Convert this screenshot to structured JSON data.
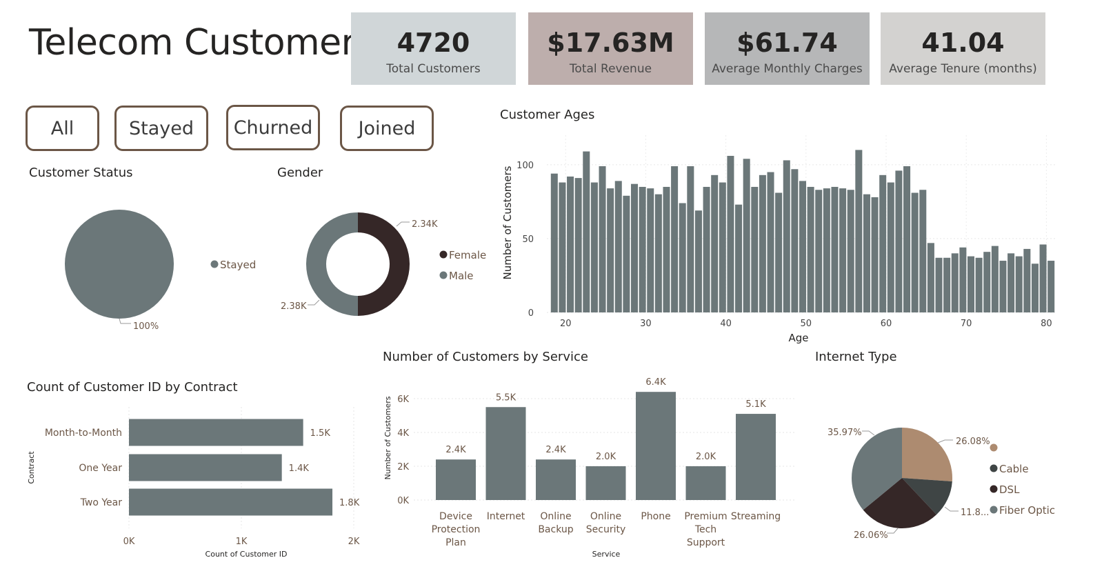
{
  "header": {
    "title": "Telecom Customers"
  },
  "kpis": [
    {
      "value": "4720",
      "label": "Total Customers",
      "color": "#d0d6d8"
    },
    {
      "value": "$17.63M",
      "label": "Total Revenue",
      "color": "#bdaeac"
    },
    {
      "value": "$61.74",
      "label": "Average Monthly Charges",
      "color": "#b6b7b8"
    },
    {
      "value": "41.04",
      "label": "Average Tenure (months)",
      "color": "#d3d2d0"
    }
  ],
  "slicers": [
    "All",
    "Stayed",
    "Churned",
    "Joined"
  ],
  "colors": {
    "slate": "#6b7779",
    "dark": "#352727",
    "tan": "#ad8b70",
    "charcoal": "#3f4545",
    "brown": "#6b5646"
  },
  "customer_status": {
    "title": "Customer Status",
    "legend": "Stayed",
    "slice_label": "100%"
  },
  "gender": {
    "title": "Gender",
    "legend": [
      "Female",
      "Male"
    ],
    "labels": {
      "female": "2.34K",
      "male": "2.38K"
    }
  },
  "contract": {
    "title": "Count of Customer ID by Contract",
    "xlabel": "Count of Customer ID",
    "ylabel": "Contract",
    "ticks": [
      "0K",
      "1K",
      "2K"
    ]
  },
  "service": {
    "title": "Number of Customers by Service",
    "xlabel": "Service",
    "ylabel": "Number of Customers",
    "ticks": [
      "0K",
      "2K",
      "4K",
      "6K"
    ]
  },
  "internet": {
    "title": "Internet Type",
    "legend": [
      "",
      "Cable",
      "DSL",
      "Fiber Optic"
    ],
    "labels": [
      "26.08%",
      "11.8...",
      "26.06%",
      "35.97%"
    ]
  },
  "ages": {
    "title": "Customer Ages",
    "xlabel": "Age",
    "ylabel": "Number of Customers",
    "xticks": [
      "20",
      "30",
      "40",
      "50",
      "60",
      "70",
      "80"
    ],
    "yticks": [
      "0",
      "50",
      "100"
    ]
  },
  "chart_data": [
    {
      "type": "pie",
      "title": "Customer Status",
      "categories": [
        "Stayed"
      ],
      "values": [
        100
      ]
    },
    {
      "type": "pie",
      "title": "Gender",
      "categories": [
        "Female",
        "Male"
      ],
      "values": [
        2340,
        2380
      ]
    },
    {
      "type": "bar",
      "orientation": "horizontal",
      "title": "Count of Customer ID by Contract",
      "categories": [
        "Month-to-Month",
        "One Year",
        "Two Year"
      ],
      "values": [
        1550,
        1360,
        1810
      ],
      "data_labels": [
        "1.5K",
        "1.4K",
        "1.8K"
      ],
      "xlabel": "Count of Customer ID",
      "ylabel": "Contract",
      "xlim": [
        0,
        2000
      ]
    },
    {
      "type": "bar",
      "title": "Number of Customers by Service",
      "categories": [
        "Device Protection Plan",
        "Internet",
        "Online Backup",
        "Online Security",
        "Phone",
        "Premium Tech Support",
        "Streaming"
      ],
      "values": [
        2400,
        5500,
        2400,
        2000,
        6400,
        2000,
        5100
      ],
      "data_labels": [
        "2.4K",
        "5.5K",
        "2.4K",
        "2.0K",
        "6.4K",
        "2.0K",
        "5.1K"
      ],
      "xlabel": "Service",
      "ylabel": "Number of Customers",
      "ylim": [
        0,
        7000
      ]
    },
    {
      "type": "pie",
      "title": "Internet Type",
      "categories": [
        "",
        "Cable",
        "DSL",
        "Fiber Optic"
      ],
      "values": [
        26.08,
        11.89,
        26.06,
        35.97
      ]
    },
    {
      "type": "bar",
      "title": "Customer Ages",
      "x": [
        19,
        20,
        21,
        22,
        23,
        24,
        25,
        26,
        27,
        28,
        29,
        30,
        31,
        32,
        33,
        34,
        35,
        36,
        37,
        38,
        39,
        40,
        41,
        42,
        43,
        44,
        45,
        46,
        47,
        48,
        49,
        50,
        51,
        52,
        53,
        54,
        55,
        56,
        57,
        58,
        59,
        60,
        61,
        62,
        63,
        64,
        65,
        66,
        67,
        68,
        69,
        70,
        71,
        72,
        73,
        74,
        75,
        76,
        77,
        78,
        79,
        80
      ],
      "values": [
        94,
        88,
        92,
        91,
        109,
        88,
        99,
        84,
        89,
        79,
        87,
        85,
        84,
        80,
        85,
        99,
        74,
        99,
        69,
        85,
        93,
        88,
        106,
        73,
        104,
        85,
        93,
        95,
        81,
        103,
        97,
        89,
        85,
        83,
        84,
        85,
        84,
        83,
        110,
        80,
        78,
        93,
        88,
        96,
        99,
        81,
        83,
        47,
        37,
        37,
        40,
        44,
        38,
        37,
        41,
        45,
        35,
        40,
        38,
        43,
        33,
        46,
        35
      ],
      "xlabel": "Age",
      "ylabel": "Number of Customers",
      "ylim": [
        0,
        120
      ],
      "xlim": [
        18,
        80
      ]
    }
  ]
}
